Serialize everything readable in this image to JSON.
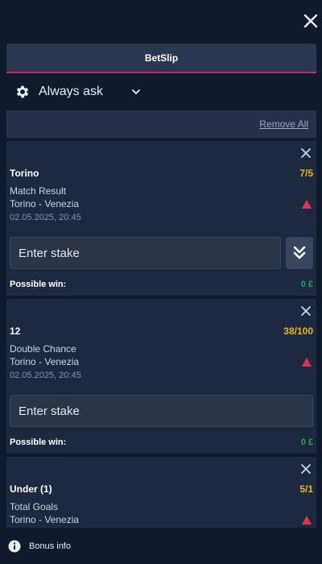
{
  "header": {
    "tab_label": "BetSlip"
  },
  "odds_setting": {
    "label": "Always ask"
  },
  "actions": {
    "remove_all": "Remove All"
  },
  "bets": [
    {
      "selection": "Torino",
      "odds": "7/5",
      "market": "Match Result",
      "event": "Torino - Venezia",
      "datetime": "02.05.2025, 20:45",
      "stake_placeholder": "Enter stake",
      "possible_win_label": "Possible win:",
      "possible_win_value": "0 £"
    },
    {
      "selection": "12",
      "odds": "38/100",
      "market": "Double Chance",
      "event": "Torino - Venezia",
      "datetime": "02.05.2025, 20:45",
      "stake_placeholder": "Enter stake",
      "possible_win_label": "Possible win:",
      "possible_win_value": "0 £"
    },
    {
      "selection": "Under (1)",
      "odds": "5/1",
      "market": "Total Goals",
      "event": "Torino - Venezia"
    }
  ],
  "footer": {
    "bonus_label": "Bonus info"
  },
  "colors": {
    "background": "#0f1a2d",
    "card": "#1d2940",
    "accent_tab_border": "#c2276a",
    "odds": "#e9b616",
    "win": "#1aa84a",
    "warning": "#e0334a"
  },
  "icons": {
    "close": "close-icon",
    "settings": "gear-icon",
    "dropdown": "chevron-down-icon",
    "remove_bet": "close-icon",
    "warning": "warning-icon",
    "multiply": "double-chevron-down-icon",
    "info": "info-icon"
  }
}
